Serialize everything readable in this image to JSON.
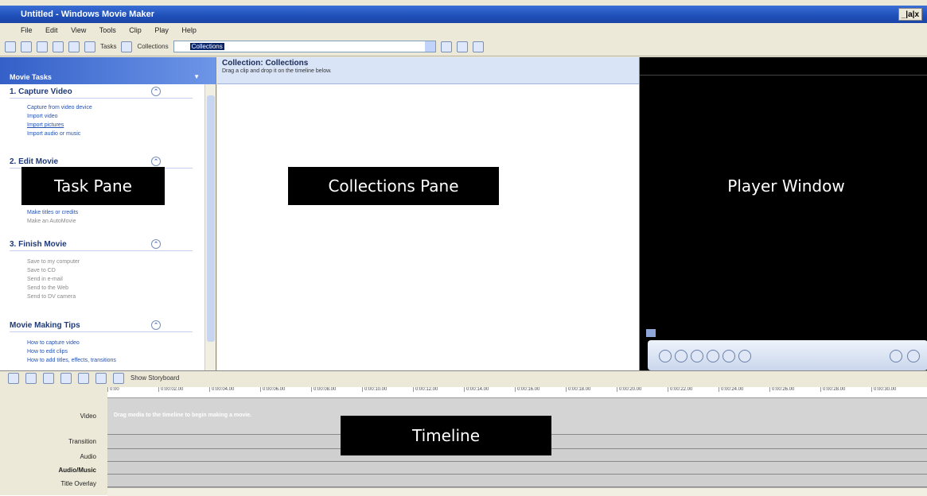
{
  "window": {
    "title": "Untitled - Windows Movie Maker",
    "controls": "_|a|x"
  },
  "menu": [
    "File",
    "Edit",
    "View",
    "Tools",
    "Clip",
    "Play",
    "Help"
  ],
  "toolbar": {
    "tasks_label": "Tasks",
    "collections_label": "Collections",
    "select_value": "Collections"
  },
  "taskpane": {
    "header": "Movie Tasks",
    "sections": [
      {
        "title": "1. Capture Video",
        "items": [
          "Capture from video device",
          "Import video",
          "Import pictures",
          "Import audio or music"
        ],
        "dim": [
          false,
          false,
          false,
          false
        ]
      },
      {
        "title": "2. Edit Movie",
        "items": [
          "Make titles or credits",
          "Make an AutoMovie"
        ],
        "dim": [
          false,
          true
        ]
      },
      {
        "title": "3. Finish Movie",
        "items": [
          "Save to my computer",
          "Save to CD",
          "Send in e-mail",
          "Send to the Web",
          "Send to DV camera"
        ],
        "dim": [
          true,
          true,
          true,
          true,
          true
        ]
      },
      {
        "title": "Movie Making Tips",
        "items": [
          "How to capture video",
          "How to edit clips",
          "How to add titles, effects, transitions"
        ],
        "dim": [
          false,
          false,
          false
        ]
      }
    ]
  },
  "collections": {
    "title": "Collection: Collections",
    "hint": "Drag a clip and drop it on the timeline below."
  },
  "timeline": {
    "show_storyboard": "Show Storyboard",
    "ruler": [
      "0:00",
      "0:00:02.00",
      "0:00:04.00",
      "0:00:06.00",
      "0:00:08.00",
      "0:00:10.00",
      "0:00:12.00",
      "0:00:14.00",
      "0:00:16.00",
      "0:00:18.00",
      "0:00:20.00",
      "0:00:22.00",
      "0:00:24.00",
      "0:00:26.00",
      "0:00:28.00",
      "0:00:30.00"
    ],
    "tracks": [
      "Video",
      "Transition",
      "Audio",
      "Audio/Music",
      "Title Overlay"
    ],
    "video_message": "Drag media to the timeline to begin making a movie."
  },
  "callouts": {
    "task_pane": "Task Pane",
    "collections_pane": "Collections Pane",
    "player_window": "Player Window",
    "timeline": "Timeline"
  }
}
